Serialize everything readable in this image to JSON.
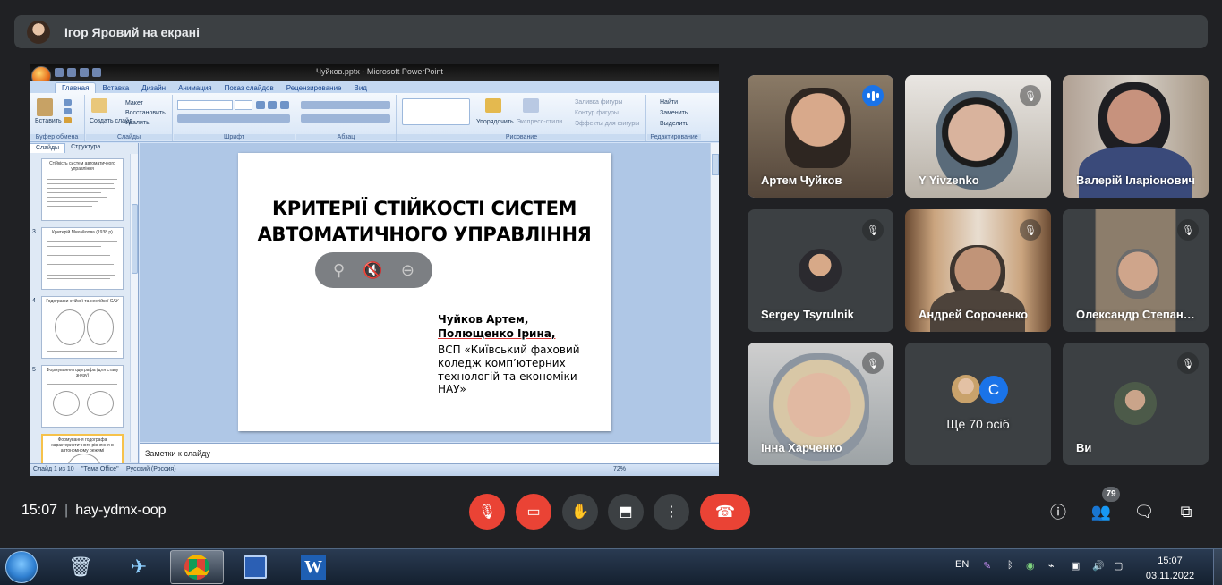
{
  "presenter": {
    "label": "Ігор Яровий на екрані"
  },
  "powerpoint": {
    "window_title": "Чуйков.pptx - Microsoft PowerPoint",
    "tabs": [
      "Главная",
      "Вставка",
      "Дизайн",
      "Анимация",
      "Показ слайдов",
      "Рецензирование",
      "Вид"
    ],
    "groups": {
      "clipboard": "Буфер обмена",
      "slides": "Слайды",
      "font": "Шрифт",
      "paragraph": "Абзац",
      "drawing": "Рисование",
      "editing": "Редактирование"
    },
    "ribbon": {
      "paste": "Вставить",
      "new_slide": "Создать слайд",
      "layout": "Макет",
      "reset": "Восстановить",
      "delete": "Удалить",
      "arrange": "Упорядочить",
      "quick_styles": "Экспресс-стили",
      "fill": "Заливка фигуры",
      "outline": "Контур фигуры",
      "effects": "Эффекты для фигуры",
      "find": "Найти",
      "replace": "Заменить",
      "select": "Выделить"
    },
    "left_tabs": {
      "slides": "Слайды",
      "outline": "Структура"
    },
    "thumbs": [
      {
        "num": "",
        "title": "Стійкість систем автоматичного управління"
      },
      {
        "num": "3",
        "title": "Критерій Михайлова (1938 р)"
      },
      {
        "num": "4",
        "title": "Годографи стійкої та нестійкої САУ"
      },
      {
        "num": "5",
        "title": "Формування годографа (для стану знизу)"
      },
      {
        "num": "",
        "title": "Формування годографа характеристичного рівняння в автономному режимі"
      }
    ],
    "slide": {
      "title_line1": "КРИТЕРІЇ СТІЙКОСТІ СИСТЕМ",
      "title_line2": "АВТОМАТИЧНОГО УПРАВЛІННЯ",
      "author1": "Чуйков Артем,",
      "author2": "Полющенко Ірина,",
      "org1": "ВСП «Київський фаховий",
      "org2": "коледж  комп’ютерних",
      "org3": "технологій та економіки",
      "org4": "НАУ»"
    },
    "notes_placeholder": "Заметки к слайду",
    "status": {
      "slide": "Слайд 1 из 10",
      "theme": "\"Тема Office\"",
      "lang": "Русский (Россия)",
      "zoom": "72%"
    }
  },
  "participants": [
    {
      "name": "Артем Чуйков",
      "state": "speaking"
    },
    {
      "name": "Y Yivzenko",
      "state": "muted"
    },
    {
      "name": "Валерій Іларіонович",
      "state": "video"
    },
    {
      "name": "Sergey Tsyrulnik",
      "state": "muted"
    },
    {
      "name": "Андрей Сороченко",
      "state": "muted"
    },
    {
      "name": "Олександр Степанович",
      "state": "muted"
    },
    {
      "name": "Інна Харченко",
      "state": "muted"
    },
    {
      "name": "Ще 70 осіб",
      "state": "group",
      "avatar_letter": "С"
    },
    {
      "name": "Ви",
      "state": "muted"
    }
  ],
  "bottom_bar": {
    "time": "15:07",
    "meeting_code": "hay-ydmx-oop",
    "people_count": "79"
  },
  "taskbar": {
    "lang": "EN",
    "time": "15:07",
    "date": "03.11.2022"
  },
  "colors": {
    "end_call": "#ea4335",
    "speaking_border": "#8ab4f8",
    "bg": "#202124",
    "tile": "#3c4043"
  }
}
